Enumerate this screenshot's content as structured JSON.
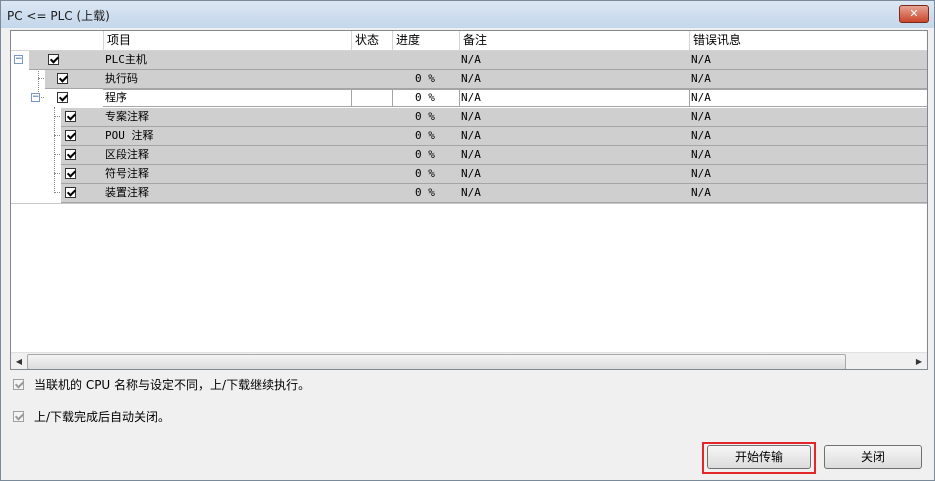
{
  "window": {
    "title": "PC <= PLC (上载)",
    "close_glyph": "✕"
  },
  "columns": [
    "项目",
    "状态",
    "进度",
    "备注",
    "错误讯息"
  ],
  "rows": [
    {
      "label": "PLC主机",
      "status": "",
      "progress": "",
      "note": "N/A",
      "error": "N/A"
    },
    {
      "label": "执行码",
      "status": "",
      "progress": "0 %",
      "note": "N/A",
      "error": "N/A"
    },
    {
      "label": "程序",
      "status": "",
      "progress": "0 %",
      "note": "N/A",
      "error": "N/A"
    },
    {
      "label": "专案注释",
      "status": "",
      "progress": "0 %",
      "note": "N/A",
      "error": "N/A"
    },
    {
      "label": "POU 注释",
      "status": "",
      "progress": "0 %",
      "note": "N/A",
      "error": "N/A"
    },
    {
      "label": "区段注释",
      "status": "",
      "progress": "0 %",
      "note": "N/A",
      "error": "N/A"
    },
    {
      "label": "符号注释",
      "status": "",
      "progress": "0 %",
      "note": "N/A",
      "error": "N/A"
    },
    {
      "label": "装置注释",
      "status": "",
      "progress": "0 %",
      "note": "N/A",
      "error": "N/A"
    }
  ],
  "options": {
    "cpu_mismatch": "当联机的 CPU 名称与设定不同，上/下载继续执行。",
    "auto_close": "上/下载完成后自动关闭。"
  },
  "buttons": {
    "start": "开始传输",
    "close": "关闭"
  },
  "expander": {
    "collapse_glyph": "−"
  },
  "scroll": {
    "left_glyph": "◀",
    "right_glyph": "▶"
  },
  "colors": {
    "highlight": "#e3262b",
    "row_gray": "#cfcfcf"
  }
}
